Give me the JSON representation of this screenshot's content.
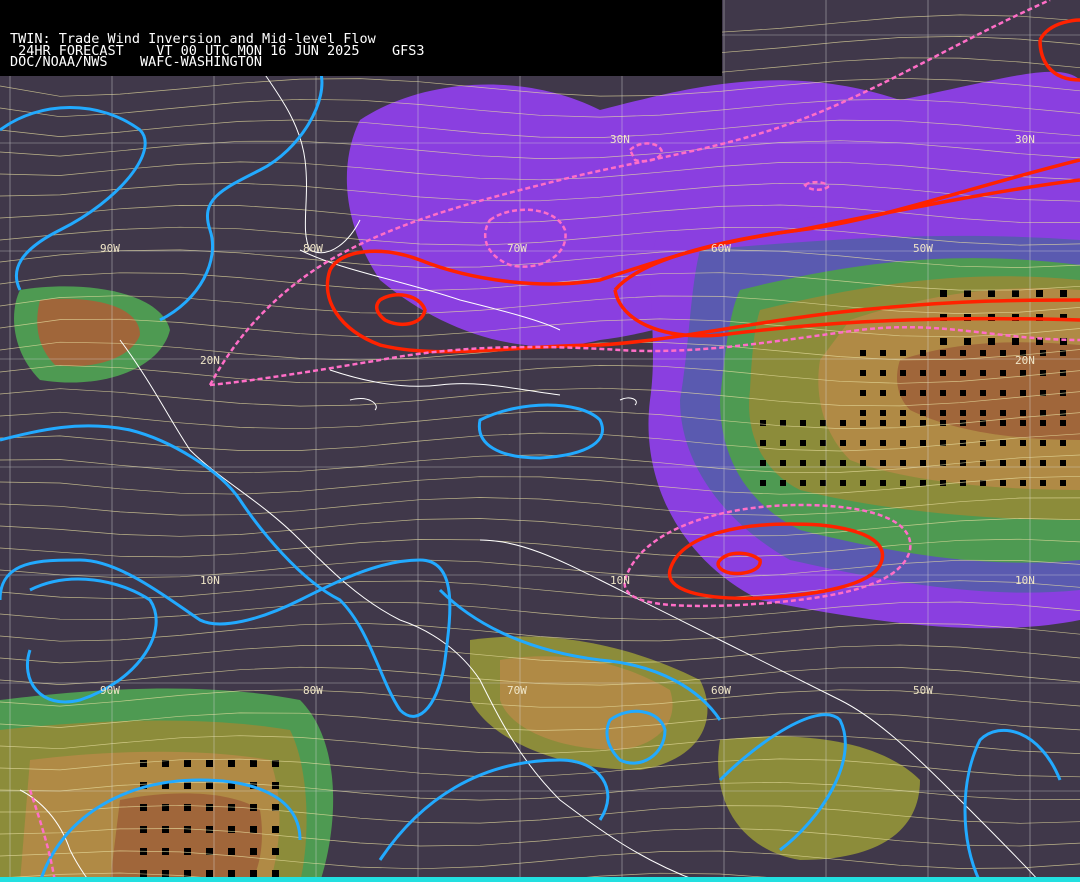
{
  "header": {
    "line1": "TWIN: Trade Wind Inversion and Mid-level Flow",
    "line2": " 24HR FORECAST    VT 00 UTC MON 16 JUN 2025    GFS3",
    "line3": "DOC/NOAA/NWS    WAFC-WASHINGTON"
  },
  "lat_labels": [
    "30N",
    "30N",
    "20N",
    "20N",
    "10N",
    "10N",
    "10N"
  ],
  "lon_labels": [
    "90W",
    "80W",
    "70W",
    "60W",
    "50W",
    "90W",
    "80W",
    "70W",
    "60W",
    "50W"
  ],
  "colors": {
    "background": "#40384a",
    "purple": "#8a3fe0",
    "blue_violet": "#5a5ab0",
    "green": "#4e9a52",
    "olive": "#8c8c3a",
    "tan": "#b08a45",
    "brown": "#a0663a",
    "streamline": "#e8dfa0",
    "coast": "#ffffff",
    "graticule": "#d8d8d8",
    "cyan_contour": "#22aaff",
    "red_contour": "#ff2200",
    "pink_dashed": "#ff6ec7"
  }
}
